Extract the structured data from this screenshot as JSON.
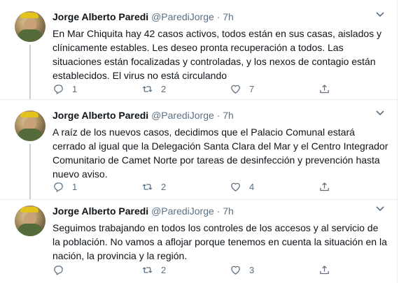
{
  "tweets": [
    {
      "author_name": "Jorge Alberto Paredi",
      "handle": "@ParediJorge",
      "separator": "·",
      "time": "7h",
      "text": "En Mar Chiquita hay 42 casos activos, todos están en sus casas, aislados y clínicamente estables. Les deseo pronta recuperación a todos. Las situaciones están focalizadas y controladas, y los nexos de contagio están establecidos. El virus no está circulando",
      "replies": "1",
      "retweets": "2",
      "likes": "7"
    },
    {
      "author_name": "Jorge Alberto Paredi",
      "handle": "@ParediJorge",
      "separator": "·",
      "time": "7h",
      "text": "A raíz de los nuevos casos, decidimos que el Palacio Comunal estará cerrado al igual que la Delegación Santa Clara del Mar y el Centro Integrador Comunitario de Camet Norte por tareas de desinfección y prevención hasta nuevo aviso.",
      "replies": "1",
      "retweets": "2",
      "likes": "4"
    },
    {
      "author_name": "Jorge Alberto Paredi",
      "handle": "@ParediJorge",
      "separator": "·",
      "time": "7h",
      "text": "Seguimos trabajando en todos los controles de los accesos y al servicio de la población. No vamos a aflojar porque tenemos en cuenta la situación en la nación, la provincia y la región.",
      "replies": "",
      "retweets": "2",
      "likes": "3"
    }
  ],
  "icons": {
    "reply": "reply-icon",
    "retweet": "retweet-icon",
    "like": "heart-icon",
    "share": "share-icon",
    "more": "chevron-down-icon"
  },
  "colors": {
    "secondary_text": "#5b7083",
    "divider": "#e6ecf0",
    "thread_line": "#c4cfd6"
  }
}
